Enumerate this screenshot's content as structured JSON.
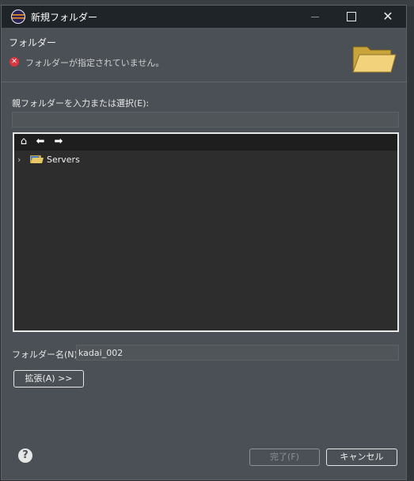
{
  "window": {
    "title": "新規フォルダー"
  },
  "header": {
    "title": "フォルダー",
    "message": "フォルダーが指定されていません。"
  },
  "form": {
    "parent_label": "親フォルダーを入力または選択(E):",
    "parent_value": "",
    "tree": {
      "toolbar_icons": [
        "home-icon",
        "back-arrow-icon",
        "forward-arrow-icon"
      ],
      "items": [
        {
          "label": "Servers",
          "expanded": false
        }
      ]
    },
    "folder_name_label": "フォルダー名(N):",
    "folder_name_value": "kadai_002"
  },
  "buttons": {
    "advanced": "拡張(A) >>",
    "finish": "完了(F)",
    "cancel": "キャンセル"
  },
  "colors": {
    "dialog_bg": "#4a5055",
    "titlebar_bg": "#1f2428",
    "tree_bg": "#2d2d2d",
    "error": "#d9363e"
  }
}
